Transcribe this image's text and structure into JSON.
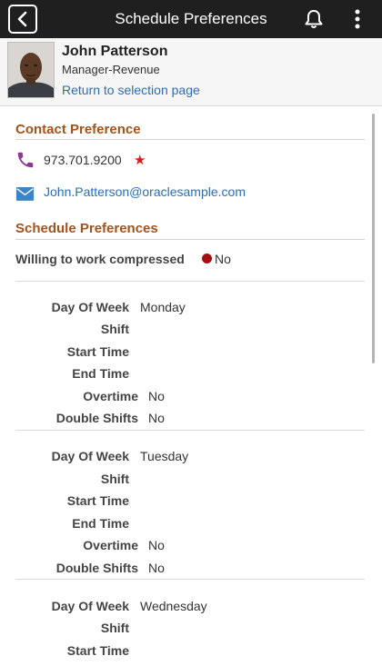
{
  "header": {
    "title": "Schedule Preferences",
    "icons": {
      "back": "chevron-left-icon",
      "notifications": "bell-icon",
      "actions": "kebab-menu-icon"
    }
  },
  "profile": {
    "name": "John Patterson",
    "role": "Manager-Revenue",
    "return_link": "Return to selection page"
  },
  "contact": {
    "section_title": "Contact Preference",
    "phone": "973.701.9200",
    "phone_marker": "★",
    "email": "John.Patterson@oraclesample.com",
    "colors": {
      "phone_icon": "#8b3a8f",
      "email_icon": "#3a86c8",
      "star": "#e0161b"
    }
  },
  "schedule": {
    "section_title": "Schedule Preferences",
    "compressed_label": "Willing to work compressed",
    "compressed_value": "No",
    "labels": {
      "day": "Day Of Week",
      "shift": "Shift",
      "start": "Start Time",
      "end": "End Time",
      "overtime": "Overtime",
      "double": "Double Shifts"
    },
    "days": [
      {
        "day": "Monday",
        "shift": "",
        "start": "",
        "end": "",
        "overtime": "No",
        "double": "No"
      },
      {
        "day": "Tuesday",
        "shift": "",
        "start": "",
        "end": "",
        "overtime": "No",
        "double": "No"
      },
      {
        "day": "Wednesday",
        "shift": "",
        "start": ""
      }
    ]
  },
  "colors": {
    "header_bg": "#1f1f1f",
    "section_title": "#a2531b",
    "link": "#2a6ebb",
    "status_dot": "#a30f13"
  }
}
